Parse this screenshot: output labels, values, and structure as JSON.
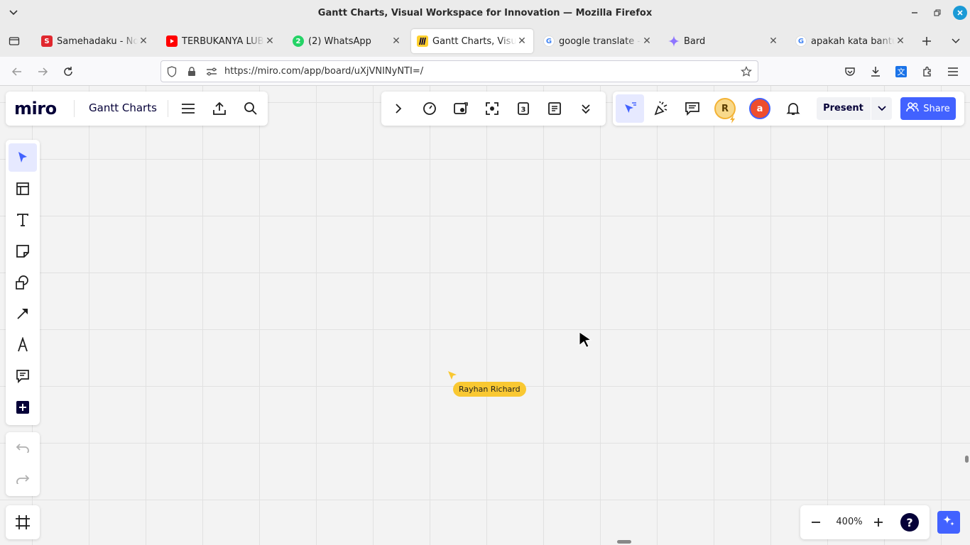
{
  "window": {
    "title": "Gantt Charts, Visual Workspace for Innovation — Mozilla Firefox"
  },
  "tabs": [
    {
      "label": "Samehadaku - Nont",
      "favicon": "samehadaku-icon",
      "color": "#e0272e",
      "active": false
    },
    {
      "label": "TERBUKANYA LUBA",
      "favicon": "youtube-icon",
      "color": "#ff0000",
      "active": false
    },
    {
      "label": "(2) WhatsApp",
      "favicon": "whatsapp-icon",
      "color": "#25d366",
      "badge": "2",
      "active": false
    },
    {
      "label": "Gantt Charts, Visual",
      "favicon": "miro-icon",
      "color": "#ffd02f",
      "active": true
    },
    {
      "label": "google translate - P",
      "favicon": "google-icon",
      "color": "#4285f4",
      "active": false
    },
    {
      "label": "Bard",
      "favicon": "bard-icon",
      "color": "#8e75ff",
      "active": false
    },
    {
      "label": "apakah kata bantua",
      "favicon": "google-icon",
      "color": "#4285f4",
      "active": false
    }
  ],
  "navbar": {
    "url": "https://miro.com/app/board/uXjVNINyNTI=/"
  },
  "miro": {
    "board_title": "Gantt Charts",
    "present_label": "Present",
    "share_label": "Share",
    "collaborators": [
      {
        "initial": "R",
        "bg": "#f8d98b",
        "fg": "#5a3d00"
      },
      {
        "initial": "a",
        "bg": "#ee4d2d",
        "fg": "#ffffff"
      }
    ],
    "cursor_user": "Rayhan Richard",
    "cursor_color": "#f9c832",
    "zoom": "400%",
    "accent": "#4262ff"
  }
}
